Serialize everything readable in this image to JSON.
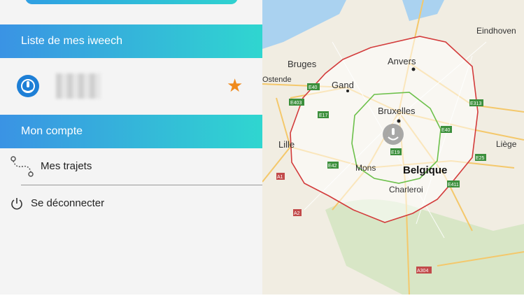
{
  "sidebar": {
    "section_devices": "Liste de mes iweech",
    "section_account": "Mon compte",
    "menu": [
      {
        "label": "Mes trajets"
      },
      {
        "label": "Se déconnecter"
      }
    ]
  },
  "map": {
    "cities": {
      "anvers": "Anvers",
      "gand": "Gand",
      "bruges": "Bruges",
      "ostende": "Ostende",
      "bruxelles": "Bruxelles",
      "lille": "Lille",
      "mons": "Mons",
      "belgique": "Belgique",
      "charleroi": "Charleroi",
      "liege": "Liège",
      "eindhoven": "Eindhoven"
    },
    "roads": {
      "e40a": "E40",
      "e403": "E403",
      "e17": "E17",
      "e313": "E313",
      "e40b": "E40",
      "e19": "E19",
      "e42": "E42",
      "e411": "E411",
      "e25": "E25",
      "a304": "A304",
      "a1": "A1",
      "a2": "A2"
    },
    "colors": {
      "outer_zone": "#d33b3b",
      "inner_zone": "#6cc04a",
      "land": "#f3efe3",
      "water": "#aad2f0"
    }
  }
}
